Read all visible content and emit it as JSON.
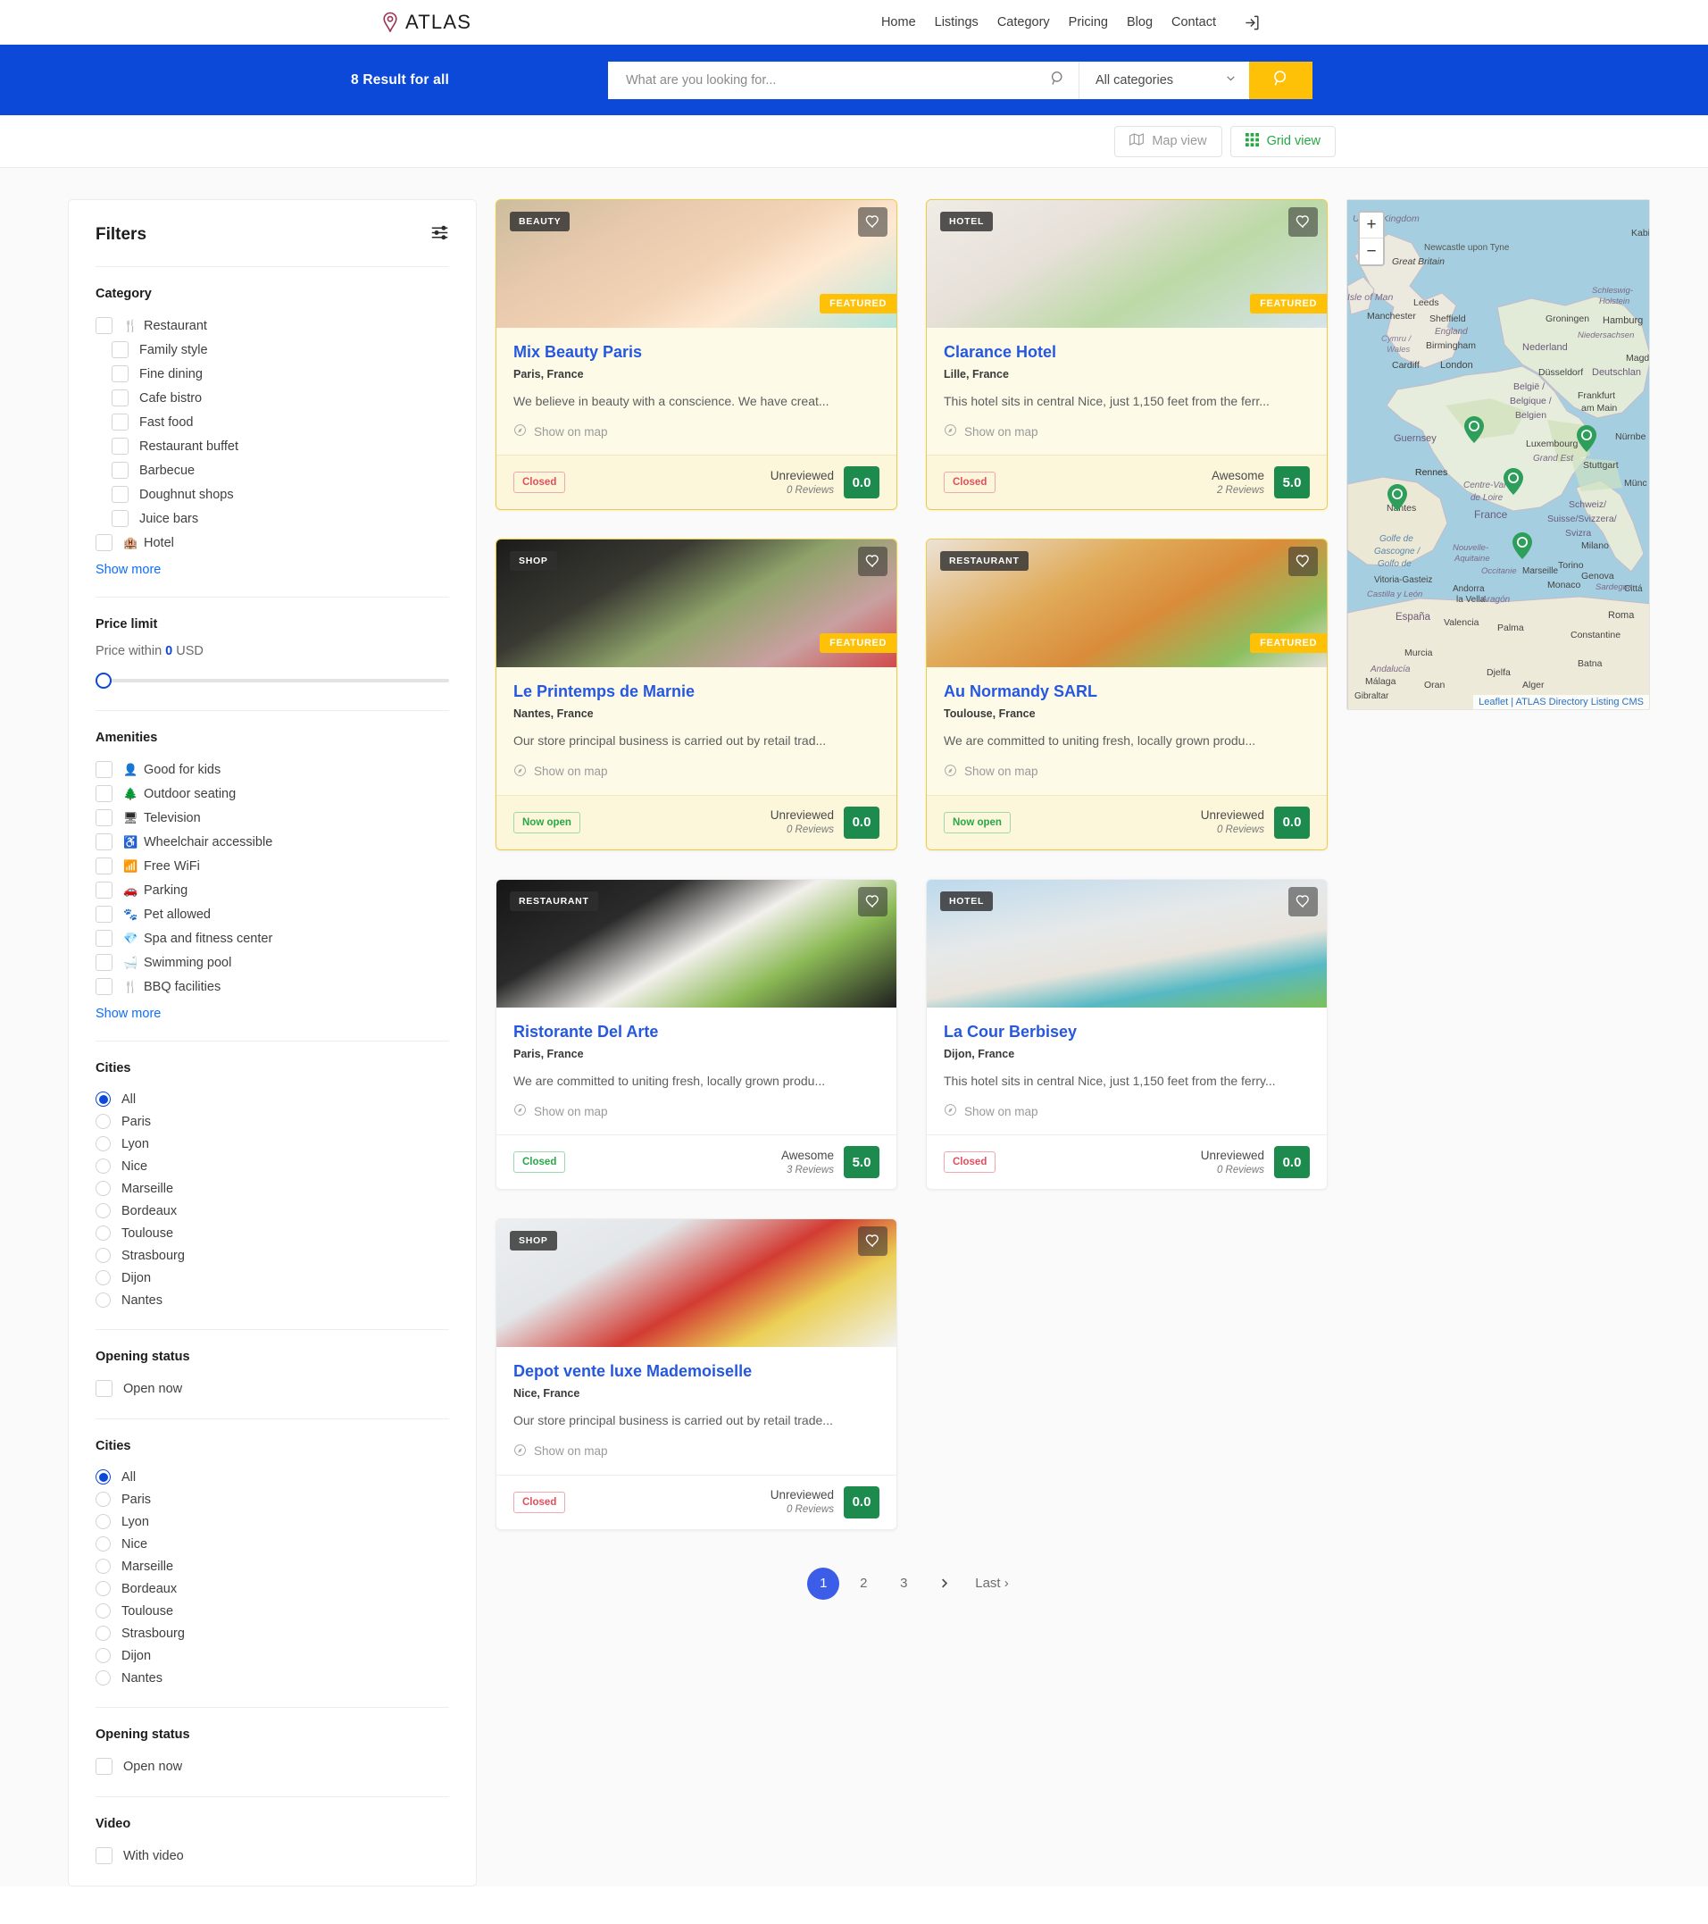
{
  "brand": {
    "name": "ATLAS",
    "logo_icon": "map-pin-icon"
  },
  "nav": {
    "items": [
      "Home",
      "Listings",
      "Category",
      "Pricing",
      "Blog",
      "Contact"
    ],
    "login_icon": "sign-in-icon"
  },
  "search": {
    "result_count_text": "8 Result for all",
    "placeholder": "What are you looking for...",
    "value": "",
    "category_selected": "All categories",
    "search_icon": "search-icon",
    "submit_icon": "search-icon",
    "chevron_icon": "chevron-down-icon"
  },
  "view_toggle": {
    "map_label": "Map view",
    "grid_label": "Grid view",
    "map_icon": "map-icon",
    "grid_icon": "grid-icon",
    "active": "Grid view",
    "active_color": "#28a745"
  },
  "filters": {
    "title": "Filters",
    "settings_icon": "sliders-icon",
    "category": {
      "title": "Category",
      "parents": [
        {
          "label": "Restaurant",
          "icon": "cutlery-icon",
          "children": [
            "Family style",
            "Fine dining",
            "Cafe bistro",
            "Fast food",
            "Restaurant buffet",
            "Barbecue",
            "Doughnut shops",
            "Juice bars"
          ]
        },
        {
          "label": "Hotel",
          "icon": "hotel-icon",
          "children": []
        }
      ],
      "show_more": "Show more"
    },
    "price": {
      "title": "Price limit",
      "label_prefix": "Price within",
      "value": "0",
      "label_suffix": "USD"
    },
    "amenities": {
      "title": "Amenities",
      "items": [
        {
          "label": "Good for kids",
          "icon": "child-icon"
        },
        {
          "label": "Outdoor seating",
          "icon": "tree-icon"
        },
        {
          "label": "Television",
          "icon": "tv-icon"
        },
        {
          "label": "Wheelchair accessible",
          "icon": "wheelchair-icon"
        },
        {
          "label": "Free WiFi",
          "icon": "wifi-icon"
        },
        {
          "label": "Parking",
          "icon": "car-icon"
        },
        {
          "label": "Pet allowed",
          "icon": "paw-icon"
        },
        {
          "label": "Spa and fitness center",
          "icon": "gem-icon"
        },
        {
          "label": "Swimming pool",
          "icon": "pool-icon"
        },
        {
          "label": "BBQ facilities",
          "icon": "cutlery-icon"
        }
      ],
      "show_more": "Show more"
    },
    "cities": {
      "title": "Cities",
      "items": [
        "All",
        "Paris",
        "Lyon",
        "Nice",
        "Marseille",
        "Bordeaux",
        "Toulouse",
        "Strasbourg",
        "Dijon",
        "Nantes"
      ],
      "selected": "All"
    },
    "opening_status": {
      "title": "Opening status",
      "items": [
        "Open now"
      ]
    },
    "cities2": {
      "title": "Cities",
      "items": [
        "All",
        "Paris",
        "Lyon",
        "Nice",
        "Marseille",
        "Bordeaux",
        "Toulouse",
        "Strasbourg",
        "Dijon",
        "Nantes"
      ],
      "selected": "All"
    },
    "opening_status2": {
      "title": "Opening status",
      "items": [
        "Open now"
      ]
    },
    "video": {
      "title": "Video",
      "items": [
        "With video"
      ]
    }
  },
  "listings": [
    {
      "category": "BEAUTY",
      "featured": true,
      "featured_label": "FEATURED",
      "title": "Mix Beauty Paris",
      "location": "Paris, France",
      "description": "We believe in beauty with a conscience. We have creat...",
      "show_on_map": "Show on map",
      "status": "Closed",
      "status_type": "closed-red",
      "rating_word": "Unreviewed",
      "rating_count": "0 Reviews",
      "score": "0.0"
    },
    {
      "category": "HOTEL",
      "featured": true,
      "featured_label": "FEATURED",
      "title": "Clarance Hotel",
      "location": "Lille, France",
      "description": "This hotel sits in central Nice, just 1,150 feet from the ferr...",
      "show_on_map": "Show on map",
      "status": "Closed",
      "status_type": "closed-red",
      "rating_word": "Awesome",
      "rating_count": "2 Reviews",
      "score": "5.0"
    },
    {
      "category": "SHOP",
      "featured": true,
      "featured_label": "FEATURED",
      "title": "Le Printemps de Marnie",
      "location": "Nantes, France",
      "description": "Our store principal business is carried out by retail trad...",
      "show_on_map": "Show on map",
      "status": "Now open",
      "status_type": "open",
      "rating_word": "Unreviewed",
      "rating_count": "0 Reviews",
      "score": "0.0"
    },
    {
      "category": "RESTAURANT",
      "featured": true,
      "featured_label": "FEATURED",
      "title": "Au Normandy SARL",
      "location": "Toulouse, France",
      "description": "We are committed to uniting fresh, locally grown produ...",
      "show_on_map": "Show on map",
      "status": "Now open",
      "status_type": "open",
      "rating_word": "Unreviewed",
      "rating_count": "0 Reviews",
      "score": "0.0"
    },
    {
      "category": "RESTAURANT",
      "featured": false,
      "featured_label": "",
      "title": "Ristorante Del Arte",
      "location": "Paris, France",
      "description": "We are committed to uniting fresh, locally grown produ...",
      "show_on_map": "Show on map",
      "status": "Closed",
      "status_type": "closed-green",
      "rating_word": "Awesome",
      "rating_count": "3 Reviews",
      "score": "5.0"
    },
    {
      "category": "HOTEL",
      "featured": false,
      "featured_label": "",
      "title": "La Cour Berbisey",
      "location": "Dijon, France",
      "description": "This hotel sits in central Nice, just 1,150 feet from the ferry...",
      "show_on_map": "Show on map",
      "status": "Closed",
      "status_type": "closed-red",
      "rating_word": "Unreviewed",
      "rating_count": "0 Reviews",
      "score": "0.0"
    },
    {
      "category": "SHOP",
      "featured": false,
      "featured_label": "",
      "title": "Depot vente luxe Mademoiselle",
      "location": "Nice, France",
      "description": "Our store principal business is carried out by retail trade...",
      "show_on_map": "Show on map",
      "status": "Closed",
      "status_type": "closed-red",
      "rating_word": "Unreviewed",
      "rating_count": "0 Reviews",
      "score": "0.0"
    }
  ],
  "pagination": {
    "pages": [
      "1",
      "2",
      "3"
    ],
    "current": "1",
    "next_icon": "chevron-right-icon",
    "last_label": "Last ›"
  },
  "map": {
    "zoom_in": "+",
    "zoom_out": "−",
    "attribution": "Leaflet | ATLAS Directory Listing CMS",
    "labels": [
      "United Kingdom",
      "Newcastle upon Tyne",
      "Great Britain",
      "Isle of Man",
      "Leeds",
      "Manchester",
      "Sheffield",
      "England",
      "Cymru / Wales",
      "Birmingham",
      "Cardiff",
      "London",
      "Groningen",
      "Hamburg",
      "Schleswig-Holstein",
      "Nederland",
      "Niedersachsen",
      "Magdeburg",
      "Düsseldorf",
      "Deutschland",
      "België / Belgique / Belgien",
      "Frankfurt am Main",
      "Guernsey",
      "Luxembourg",
      "Nürnberg",
      "Stuttgart",
      "Rennes",
      "Grand Est",
      "München",
      "Centre-Val de Loire",
      "France",
      "Schweiz/Suisse/Svizzera/Svizra",
      "Milano",
      "Golfe de Gascogne / Golfo de Vizcaya",
      "Nouvelle-Aquitaine",
      "Occitanie",
      "Torino",
      "Monaco",
      "Genova",
      "Vitoria-Gasteiz",
      "Andorra la Vella",
      "Aragón",
      "Castilla y León",
      "España",
      "Valencia",
      "Palma",
      "Roma",
      "Murcia",
      "Andalucía",
      "Málaga",
      "Oran",
      "Alger",
      "Constantine",
      "Gibraltar",
      "Batna",
      "Djelfa",
      "Marseille",
      "Sardegna",
      "Kabi"
    ],
    "markers": 5,
    "marker_color": "#2e9e5b"
  }
}
